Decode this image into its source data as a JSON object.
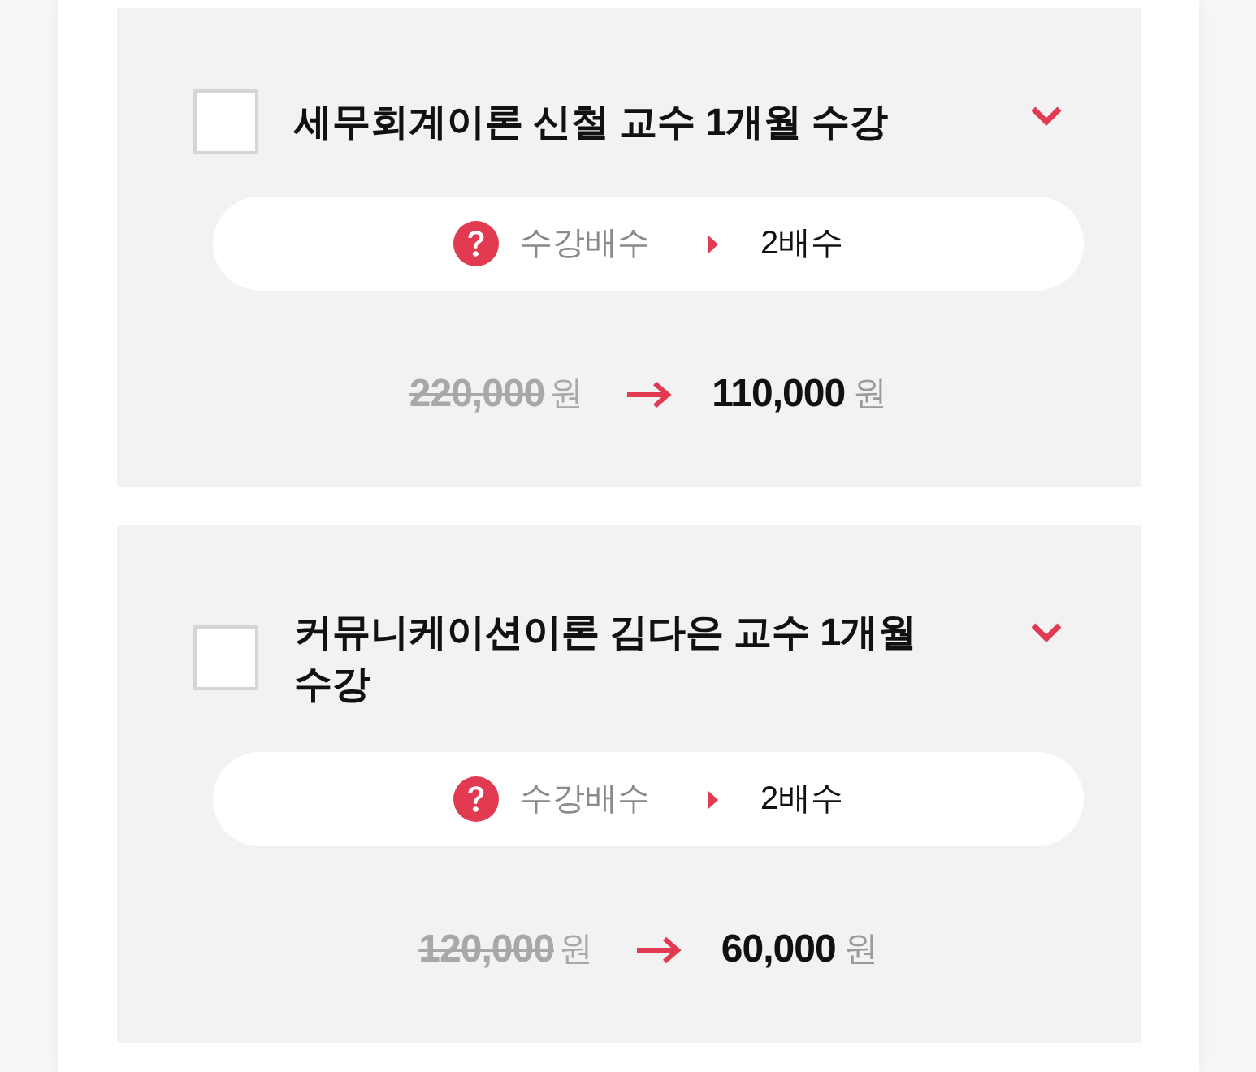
{
  "items": [
    {
      "title": "세무회계이론 신철 교수 1개월 수강",
      "checked": false,
      "expanded": false,
      "multiplier": {
        "label": "수강배수",
        "value": "2배수"
      },
      "price": {
        "original": "220,000",
        "original_unit": "원",
        "discounted": "110,000",
        "discounted_unit": "원"
      }
    },
    {
      "title": "커뮤니케이션이론 김다은 교수 1개월 수강",
      "checked": false,
      "expanded": false,
      "multiplier": {
        "label": "수강배수",
        "value": "2배수"
      },
      "price": {
        "original": "120,000",
        "original_unit": "원",
        "discounted": "60,000",
        "discounted_unit": "원"
      }
    }
  ]
}
